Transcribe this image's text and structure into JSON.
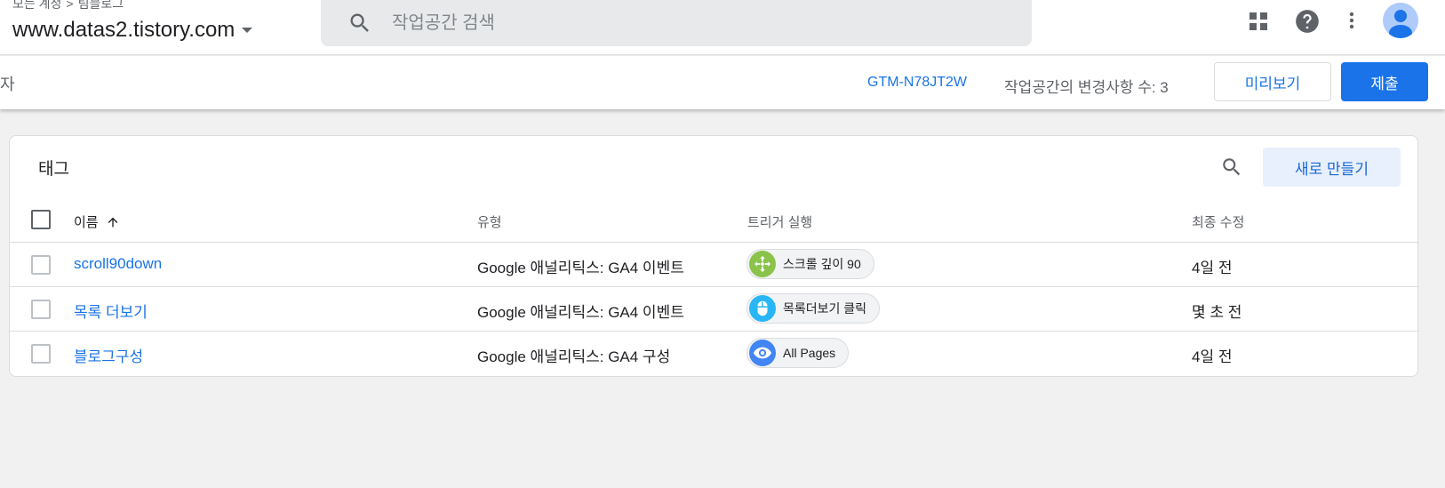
{
  "header": {
    "breadcrumb_account": "모든 계정",
    "breadcrumb_separator": ">",
    "breadcrumb_container": "팀블로그",
    "container_name": "www.datas2.tistory.com",
    "search_placeholder": "작업공간 검색"
  },
  "workspace": {
    "left_text": "자",
    "container_id": "GTM-N78JT2W",
    "changes_label": "작업공간의 변경사항 수: 3",
    "preview_label": "미리보기",
    "submit_label": "제출"
  },
  "tags": {
    "title": "태그",
    "new_label": "새로 만들기",
    "columns": {
      "name": "이름",
      "type": "유형",
      "trigger": "트리거 실행",
      "modified": "최종 수정"
    },
    "rows": [
      {
        "name": "scroll90down",
        "type": "Google 애널리틱스: GA4 이벤트",
        "trigger": "스크롤 깊이 90",
        "trigger_icon": "scroll-depth-icon",
        "trigger_color": "#8bc34a",
        "modified": "4일 전"
      },
      {
        "name": "목록 더보기",
        "type": "Google 애널리틱스: GA4 이벤트",
        "trigger": "목록더보기 클릭",
        "trigger_icon": "mouse-click-icon",
        "trigger_color": "#29b6f6",
        "modified": "몇 초 전"
      },
      {
        "name": "블로그구성",
        "type": "Google 애널리틱스: GA4 구성",
        "trigger": "All Pages",
        "trigger_icon": "eye-icon",
        "trigger_color": "#4285f4",
        "modified": "4일 전"
      }
    ]
  },
  "colors": {
    "accent": "#1a73e8",
    "background": "#f1f1f2"
  }
}
